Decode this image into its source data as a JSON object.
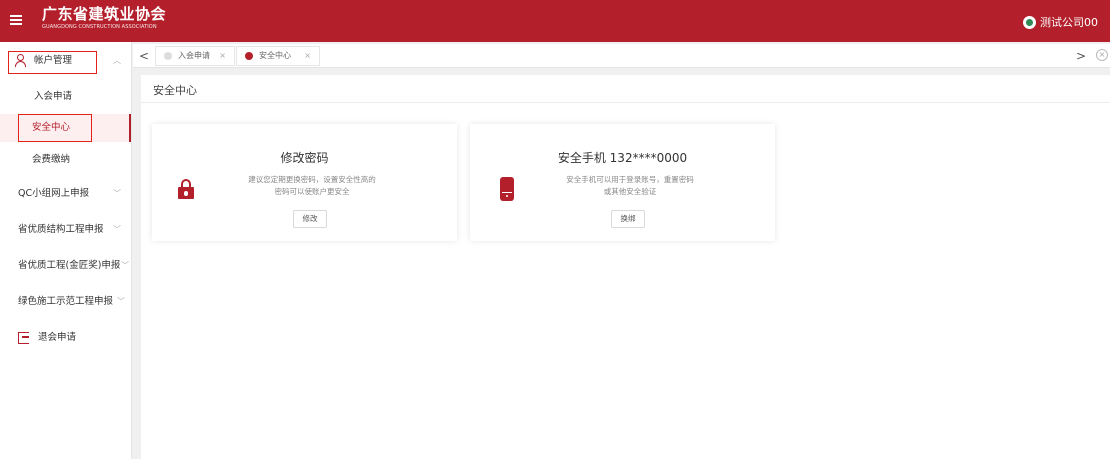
{
  "header": {
    "logo_cn": "广东省建筑业协会",
    "logo_en": "GUANGDONG CONSTRUCTION ASSOCIATION",
    "user_name": "测试公司00"
  },
  "sidebar": {
    "items": [
      {
        "label": "帐户管理"
      },
      {
        "label": "入会申请"
      },
      {
        "label": "安全中心"
      },
      {
        "label": "会费缴纳"
      },
      {
        "label": "QC小组网上申报"
      },
      {
        "label": "省优质结构工程申报"
      },
      {
        "label": "省优质工程(金匠奖)申报"
      },
      {
        "label": "绿色施工示范工程申报"
      },
      {
        "label": "退会申请"
      }
    ]
  },
  "tabs": [
    {
      "label": "入会申请",
      "close": "×"
    },
    {
      "label": "安全中心",
      "close": "×"
    }
  ],
  "tab_nav": {
    "prev": "<",
    "next": ">",
    "close_all": "×"
  },
  "content": {
    "title": "安全中心",
    "cards": [
      {
        "title": "修改密码",
        "desc_line1": "建议您定期更换密码，设置安全性高的",
        "desc_line2": "密码可以使账户更安全",
        "button": "修改"
      },
      {
        "title": "安全手机 132****0000",
        "desc_line1": "安全手机可以用于登录账号，重置密码",
        "desc_line2": "或其他安全验证",
        "button": "换绑"
      }
    ]
  },
  "colors": {
    "brand": "#b3202c",
    "highlight_box": "#e2231a"
  }
}
